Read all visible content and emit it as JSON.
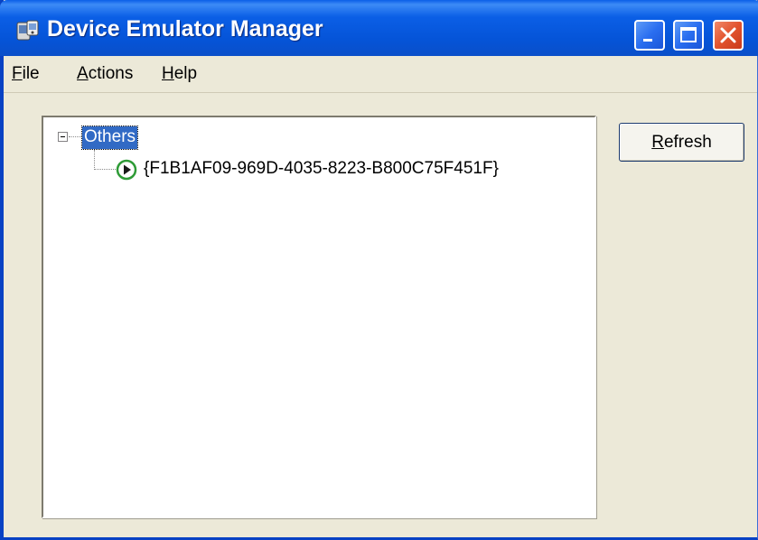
{
  "window": {
    "title": "Device Emulator Manager"
  },
  "menu": [
    {
      "mnemonic": "F",
      "rest": "ile"
    },
    {
      "mnemonic": "A",
      "rest": "ctions"
    },
    {
      "mnemonic": "H",
      "rest": "elp"
    }
  ],
  "tree": {
    "group": {
      "label": "Others",
      "expanded": true,
      "selected": true
    },
    "device": {
      "label": "{F1B1AF09-969D-4035-8223-B800C75F451F}",
      "icon": "play-circle-icon",
      "icon_color": "#2e9b36"
    }
  },
  "buttons": {
    "refresh": {
      "mnemonic": "R",
      "rest": "efresh"
    }
  },
  "colors": {
    "titlebar": "#0554d8",
    "selection": "#316ac5",
    "window_bg": "#ece9d8",
    "close_button": "#e2532d"
  }
}
